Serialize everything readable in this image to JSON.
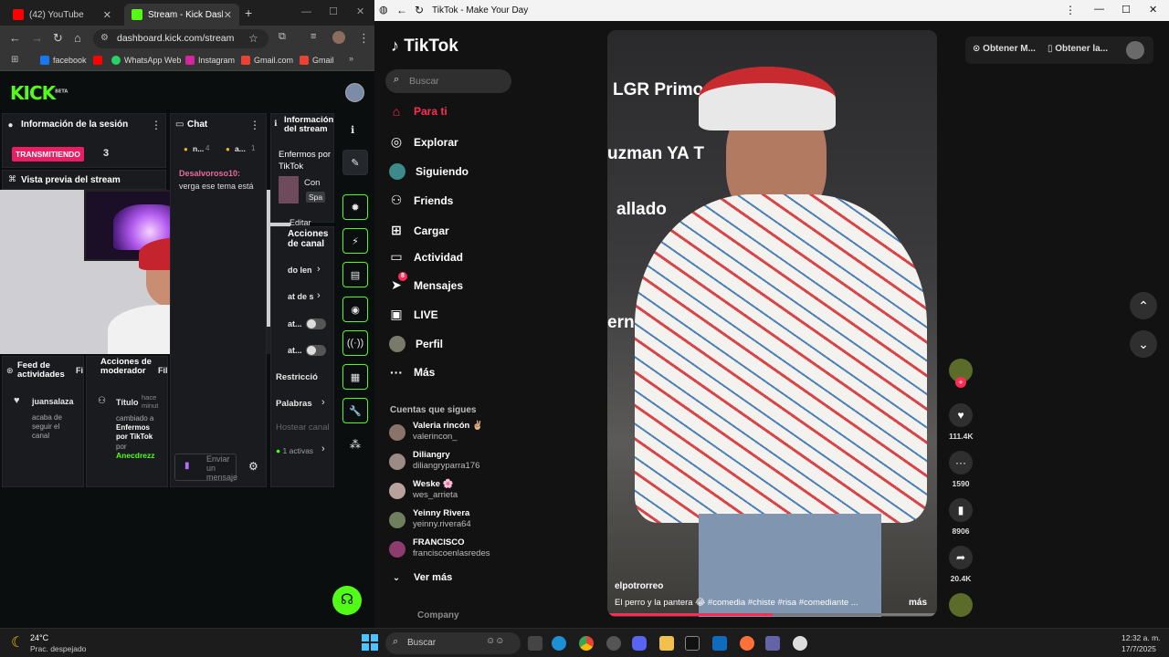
{
  "chrome": {
    "tabs": [
      {
        "label": "(42) YouTube"
      },
      {
        "label": "Stream - Kick Dashboa"
      }
    ],
    "url": "dashboard.kick.com/stream",
    "bookmarks": [
      "facebook",
      "WhatsApp Web",
      "Instagram",
      "Gmail.com",
      "Gmail"
    ]
  },
  "kick": {
    "logo": "KICK",
    "logo_badge": "BETA",
    "session": {
      "title": "Información de la sesión",
      "status": "TRANSMITIENDO",
      "viewers": "3"
    },
    "preview": {
      "title": "Vista previa del stream"
    },
    "chat": {
      "title": "Chat",
      "stat1": "n...",
      "stat1_count": "4",
      "stat2": "a...",
      "stat2_count": "1",
      "username": "Desalvoroso10",
      "message": "verga ese tema está",
      "input_placeholder": "Enviar un mensaje"
    },
    "stream_info": {
      "title": "Información del stream",
      "stream_title": "Enfermos por TikTok",
      "category": "Con",
      "lang": "Spa",
      "edit": "Editar"
    },
    "channel_actions": {
      "title": "Acciones de canal",
      "items": [
        "do len",
        "at de s",
        "at...",
        "at..."
      ]
    },
    "moderation": {
      "items": [
        "Restricció",
        "Palabras",
        "Hostear canal"
      ],
      "active": "1 activas"
    },
    "feed": {
      "title": "Feed de actividades",
      "filter": "Fi",
      "user": "juansalaza",
      "text": "acaba de seguir el canal"
    },
    "mod_actions": {
      "title": "Acciones de moderador",
      "filter": "Fil",
      "item_label": "Título",
      "time": "hace minut",
      "text": "cambiado a",
      "value": "Enfermos por TikTok",
      "by": "por",
      "moderator": "Anecdrezz"
    }
  },
  "tiktok": {
    "window_title": "TikTok - Make Your Day",
    "logo": "TikTok",
    "search_placeholder": "Buscar",
    "nav": [
      {
        "label": "Para ti",
        "icon": "home-icon",
        "active": true
      },
      {
        "label": "Explorar",
        "icon": "compass-icon"
      },
      {
        "label": "Siguiendo",
        "icon": "following-icon"
      },
      {
        "label": "Friends",
        "icon": "friends-icon"
      },
      {
        "label": "Cargar",
        "icon": "upload-icon"
      },
      {
        "label": "Actividad",
        "icon": "activity-icon"
      },
      {
        "label": "Mensajes",
        "icon": "messages-icon",
        "badge": "8"
      },
      {
        "label": "LIVE",
        "icon": "live-icon"
      },
      {
        "label": "Perfil",
        "icon": "profile-icon"
      },
      {
        "label": "Más",
        "icon": "more-icon"
      }
    ],
    "following_title": "Cuentas que sigues",
    "following": [
      {
        "name": "Valeria rincón ✌🏼",
        "handle": "valerincon_"
      },
      {
        "name": "Diliangry",
        "handle": "diliangryparra176"
      },
      {
        "name": "Weske 🌸",
        "handle": "wes_arrieta"
      },
      {
        "name": "Yeinny Rivera",
        "handle": "yeinny.rivera64"
      },
      {
        "name": "FRANCISCO",
        "handle": "franciscoenlasredes"
      }
    ],
    "see_more": "Ver más",
    "company": "Company",
    "header_buttons": [
      "Obtener M...",
      "Obtener la..."
    ],
    "video": {
      "author": "elpotrorreo",
      "caption": "El perro y la pantera 😂 #comedia #chiste #risa #comediante ...",
      "more": "más",
      "overlay_lines": [
        "LGR  Primo y",
        "uzman  YA T",
        "allado",
        "ernandez"
      ]
    },
    "actions": [
      {
        "icon": "heart-icon",
        "count": "111.4K"
      },
      {
        "icon": "comment-icon",
        "count": "1590"
      },
      {
        "icon": "bookmark-icon",
        "count": "8906"
      },
      {
        "icon": "share-icon",
        "count": "20.4K"
      }
    ]
  },
  "taskbar": {
    "weather_temp": "24°C",
    "weather_desc": "Prac. despejado",
    "search": "Buscar",
    "time": "12:32 a. m.",
    "date": "17/7/2025"
  }
}
